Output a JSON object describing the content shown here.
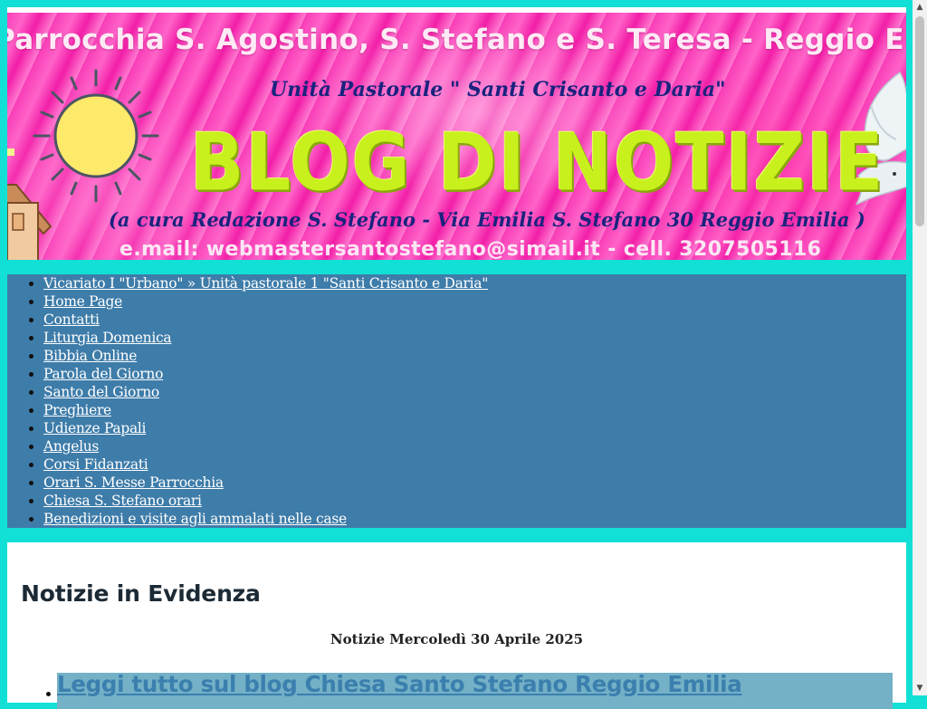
{
  "banner": {
    "title": "Parrocchia S. Agostino, S. Stefano e S. Teresa - Reggio Emilia",
    "subtitle": "Unità Pastorale \" Santi Crisanto e Daria\"",
    "big_text": "BLOG DI NOTIZIE",
    "address": "(a cura Redazione S. Stefano  - Via Emilia S. Stefano 30 Reggio Emilia )",
    "contact": "e.mail: webmastersantostefano@simail.it - cell. 3207505116",
    "icons": [
      "sun-icon",
      "dove-icon",
      "house-icon"
    ]
  },
  "nav": {
    "items": [
      "Vicariato I \"Urbano\" » Unità pastorale 1 \"Santi Crisanto e Daria\"",
      "Home Page",
      "Contatti",
      "Liturgia Domenica",
      "Bibbia Online",
      "Parola del Giorno",
      "Santo del Giorno",
      "Preghiere",
      "Udienze Papali",
      "Angelus",
      "Corsi Fidanzati",
      "Orari S. Messe Parrocchia",
      "Chiesa S. Stefano orari",
      "Benedizioni e visite agli ammalati nelle case"
    ]
  },
  "content": {
    "section_title": "Notizie in Evidenza",
    "date_line": "Notizie Mercoledì 30 Aprile 2025",
    "featured_link": "Leggi tutto sul blog Chiesa Santo Stefano Reggio Emilia"
  },
  "colors": {
    "page_background": "#12e0d6",
    "nav_background": "#3e7ca9",
    "featured_background": "#74b1c7",
    "banner_pink": "#ff4dc0",
    "banner_lime": "#c8f01c"
  }
}
